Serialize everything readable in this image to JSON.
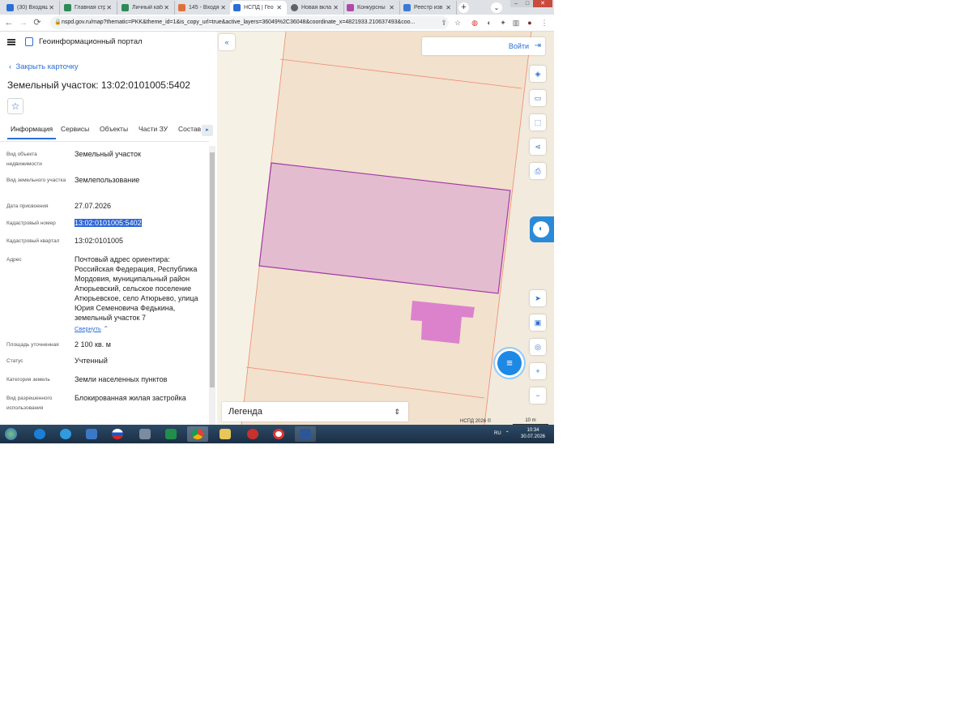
{
  "browser": {
    "tabs": [
      {
        "title": "(30) Входящ",
        "color": "#2a6fd6"
      },
      {
        "title": "Главная стр",
        "color": "#2e8b57"
      },
      {
        "title": "Личный каб",
        "color": "#2e8b57"
      },
      {
        "title": "145 - Входя",
        "color": "#e0703a"
      },
      {
        "title": "НСПД | Гео",
        "color": "#2a6fd6"
      },
      {
        "title": "Новая вкла",
        "color": "#5f6368"
      },
      {
        "title": "Конкурсны",
        "color": "#b04aa8"
      },
      {
        "title": "Реестр изв",
        "color": "#3b7bd8"
      }
    ],
    "url": "nspd.gov.ru/map?thematic=PKK&theme_id=1&is_copy_url=true&active_layers=36049%2C36048&coordinate_x=4821933.210637493&coo..."
  },
  "header": {
    "portal_name": "Геоинформационный портал"
  },
  "card": {
    "close_label": "Закрыть карточку",
    "title": "Земельный участок: 13:02:0101005:5402",
    "tabs": [
      "Информация",
      "Сервисы",
      "Объекты",
      "Части ЗУ",
      "Состав"
    ],
    "fields": [
      {
        "label": "Вид объекта недвижимости",
        "value": "Земельный участок"
      },
      {
        "label": "Вид земельного участка",
        "value": "Землепользование"
      },
      {
        "label": "Дата присвоения",
        "value": "27.07.2026"
      },
      {
        "label": "Кадастровый номер",
        "value": "13:02:0101005:5402"
      },
      {
        "label": "Кадастровый квартал",
        "value": "13:02:0101005"
      },
      {
        "label": "Адрес",
        "value": "Почтовый адрес ориентира: Российская Федерация, Республика Мордовия, муниципальный район Атюрьевский, сельское поселение Атюрьевское, село Атюрьево, улица Юрия Семеновича Федькина, земельный участок 7"
      },
      {
        "label": "Площадь уточненная",
        "value": "2 100 кв. м"
      },
      {
        "label": "Статус",
        "value": "Учтенный"
      },
      {
        "label": "Категория земель",
        "value": "Земли населенных пунктов"
      },
      {
        "label": "Вид разрешенного использования",
        "value": "Блокированная жилая застройка"
      }
    ],
    "collapse_label": "Свернуть"
  },
  "map": {
    "login_label": "Войти",
    "legend_label": "Легенда",
    "copyright": "НСПД 2026 ©",
    "scale_label": "10 m",
    "parcel_fill": "#e3bcd0",
    "parcel_stroke": "#a23aa5",
    "building_fill": "#dc82cd",
    "boundary_color": "#f08a70"
  },
  "taskbar": {
    "lang": "RU",
    "time": "10:34",
    "date": "30.07.2026"
  }
}
